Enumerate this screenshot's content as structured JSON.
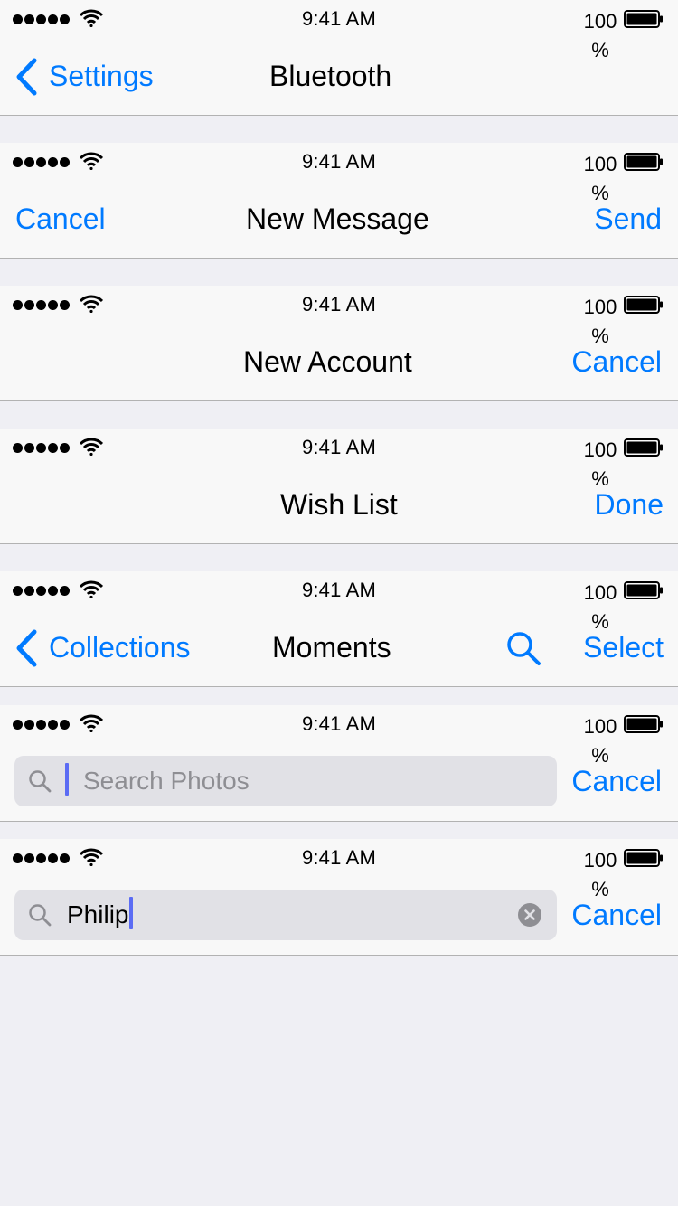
{
  "colors": {
    "accent": "#007aff",
    "bar_background": "#f8f8f8",
    "page_background": "#efeff4",
    "separator": "#b2b2b2",
    "search_field": "#e1e1e6",
    "placeholder": "#8e8e93",
    "cursor": "#5b6cf4"
  },
  "status": {
    "time": "9:41 AM",
    "battery_text": "100 %",
    "battery_level": 1.0,
    "signal_bars": 5,
    "icons": [
      "signal-dots-icon",
      "wifi-icon",
      "battery-icon"
    ]
  },
  "bars": [
    {
      "back_label": "Settings",
      "back_icon": "chevron-left-icon",
      "title": "Bluetooth"
    },
    {
      "left_button": "Cancel",
      "title": "New Message",
      "right_button": "Send"
    },
    {
      "title": "New Account",
      "right_button": "Cancel"
    },
    {
      "title": "Wish List",
      "right_button": "Done"
    },
    {
      "back_label": "Collections",
      "back_icon": "chevron-left-icon",
      "title": "Moments",
      "action_icon": "search-icon",
      "right_button": "Select"
    },
    {
      "search_placeholder": "Search Photos",
      "search_value": "",
      "right_button": "Cancel"
    },
    {
      "search_placeholder": "",
      "search_value": "Philip",
      "clear_icon": "clear-circle-icon",
      "right_button": "Cancel"
    }
  ]
}
